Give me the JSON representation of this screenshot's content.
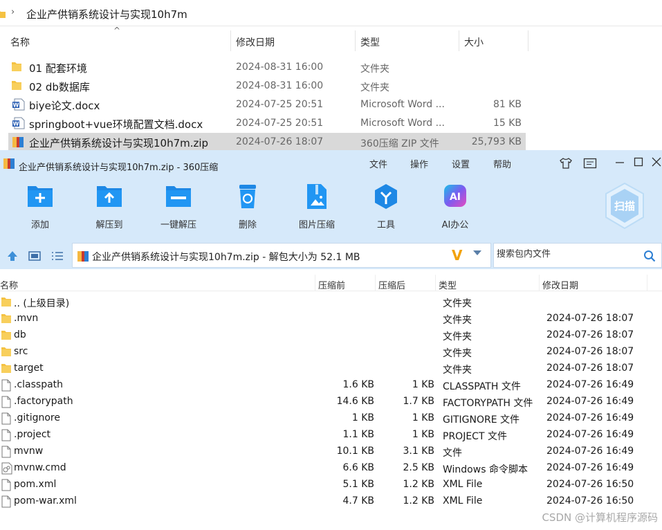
{
  "explorer": {
    "path": "企业产供销系统设计与实现10h7m",
    "columns": {
      "name": "名称",
      "date": "修改日期",
      "type": "类型",
      "size": "大小"
    },
    "rows": [
      {
        "icon": "folder-icon",
        "name": "01 配套环境",
        "date": "2024-08-31 16:00",
        "type": "文件夹",
        "size": "",
        "selected": false
      },
      {
        "icon": "folder-icon",
        "name": "02 db数据库",
        "date": "2024-08-31 16:00",
        "type": "文件夹",
        "size": "",
        "selected": false
      },
      {
        "icon": "word-doc-icon",
        "name": "biye论文.docx",
        "date": "2024-07-25 20:51",
        "type": "Microsoft Word ...",
        "size": "81 KB",
        "selected": false
      },
      {
        "icon": "word-doc-icon",
        "name": "springboot+vue环境配置文档.docx",
        "date": "2024-07-25 20:51",
        "type": "Microsoft Word ...",
        "size": "15 KB",
        "selected": false
      },
      {
        "icon": "zip-archive-icon",
        "name": "企业产供销系统设计与实现10h7m.zip",
        "date": "2024-07-26 18:07",
        "type": "360压缩 ZIP 文件",
        "size": "25,793 KB",
        "selected": true
      }
    ]
  },
  "app": {
    "title": "企业产供销系统设计与实现10h7m.zip - 360压缩",
    "menu": [
      "文件",
      "操作",
      "设置",
      "帮助"
    ],
    "toolbar": [
      {
        "label": "添加",
        "icon": "add-folder-icon"
      },
      {
        "label": "解压到",
        "icon": "extract-to-icon"
      },
      {
        "label": "一键解压",
        "icon": "one-click-extract-icon"
      },
      {
        "label": "删除",
        "icon": "delete-bin-icon"
      },
      {
        "label": "图片压缩",
        "icon": "image-compress-icon"
      },
      {
        "label": "工具",
        "icon": "tools-icon"
      },
      {
        "label": "AI办公",
        "icon": "ai-office-icon"
      }
    ],
    "scan_label": "扫描",
    "address": "企业产供销系统设计与实现10h7m.zip - 解包大小为 52.1 MB",
    "search_placeholder": "搜索包内文件",
    "columns": {
      "name": "名称",
      "compressed_before": "压缩前",
      "compressed_after": "压缩后",
      "type": "类型",
      "date": "修改日期"
    },
    "files": [
      {
        "icon": "folder-icon",
        "name": ".. (上级目录)",
        "before": "",
        "after": "",
        "type": "文件夹",
        "date": ""
      },
      {
        "icon": "folder-icon",
        "name": ".mvn",
        "before": "",
        "after": "",
        "type": "文件夹",
        "date": "2024-07-26 18:07"
      },
      {
        "icon": "folder-icon",
        "name": "db",
        "before": "",
        "after": "",
        "type": "文件夹",
        "date": "2024-07-26 18:07"
      },
      {
        "icon": "folder-icon",
        "name": "src",
        "before": "",
        "after": "",
        "type": "文件夹",
        "date": "2024-07-26 18:07"
      },
      {
        "icon": "folder-icon",
        "name": "target",
        "before": "",
        "after": "",
        "type": "文件夹",
        "date": "2024-07-26 18:07"
      },
      {
        "icon": "file-icon",
        "name": ".classpath",
        "before": "1.6 KB",
        "after": "1 KB",
        "type": "CLASSPATH 文件",
        "date": "2024-07-26 16:49"
      },
      {
        "icon": "file-icon",
        "name": ".factorypath",
        "before": "14.6 KB",
        "after": "1.7 KB",
        "type": "FACTORYPATH 文件",
        "date": "2024-07-26 16:49"
      },
      {
        "icon": "file-icon",
        "name": ".gitignore",
        "before": "1 KB",
        "after": "1 KB",
        "type": "GITIGNORE 文件",
        "date": "2024-07-26 16:49"
      },
      {
        "icon": "file-icon",
        "name": ".project",
        "before": "1.1 KB",
        "after": "1 KB",
        "type": "PROJECT 文件",
        "date": "2024-07-26 16:49"
      },
      {
        "icon": "file-icon",
        "name": "mvnw",
        "before": "10.1 KB",
        "after": "3.1 KB",
        "type": "文件",
        "date": "2024-07-26 16:49"
      },
      {
        "icon": "cmd-script-icon",
        "name": "mvnw.cmd",
        "before": "6.6 KB",
        "after": "2.5 KB",
        "type": "Windows 命令脚本",
        "date": "2024-07-26 16:49"
      },
      {
        "icon": "file-icon",
        "name": "pom.xml",
        "before": "5.1 KB",
        "after": "1.2 KB",
        "type": "XML File",
        "date": "2024-07-26 16:50"
      },
      {
        "icon": "file-icon",
        "name": "pom-war.xml",
        "before": "4.7 KB",
        "after": "1.2 KB",
        "type": "XML File",
        "date": "2024-07-26 16:50"
      }
    ]
  },
  "watermark": "CSDN @计算机程序源码",
  "colors": {
    "window_bg": "#d6e9fa",
    "accent_blue": "#1e88e5",
    "folder_yellow": "#f5c242",
    "selected_row": "#d9d9d9"
  }
}
